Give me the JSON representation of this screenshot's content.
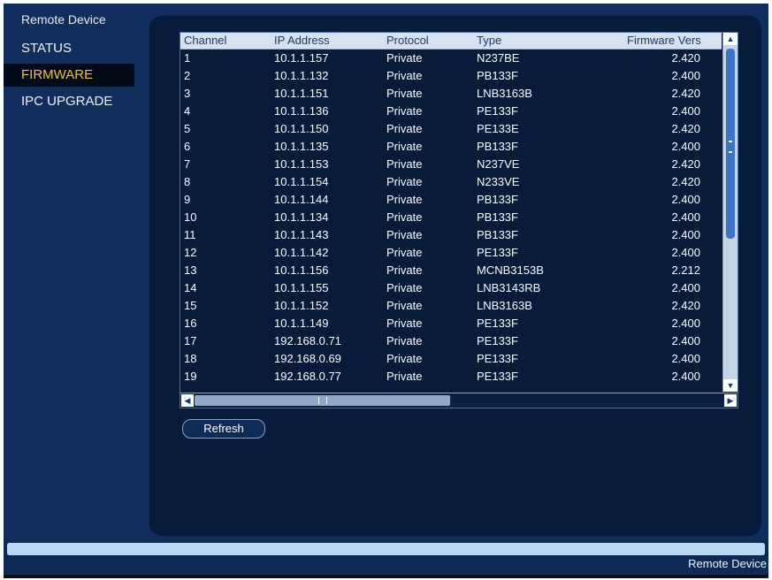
{
  "sidebar": {
    "header": "Remote Device",
    "items": [
      {
        "label": "STATUS"
      },
      {
        "label": "FIRMWARE"
      },
      {
        "label": "IPC UPGRADE"
      }
    ]
  },
  "table": {
    "columns": [
      "Channel",
      "IP Address",
      "Protocol",
      "Type",
      "Firmware Vers"
    ],
    "rows": [
      [
        "1",
        "10.1.1.157",
        "Private",
        "N237BE",
        "2.420"
      ],
      [
        "2",
        "10.1.1.132",
        "Private",
        "PB133F",
        "2.400"
      ],
      [
        "3",
        "10.1.1.151",
        "Private",
        "LNB3163B",
        "2.420"
      ],
      [
        "4",
        "10.1.1.136",
        "Private",
        "PE133F",
        "2.400"
      ],
      [
        "5",
        "10.1.1.150",
        "Private",
        "PE133E",
        "2.420"
      ],
      [
        "6",
        "10.1.1.135",
        "Private",
        "PB133F",
        "2.400"
      ],
      [
        "7",
        "10.1.1.153",
        "Private",
        "N237VE",
        "2.420"
      ],
      [
        "8",
        "10.1.1.154",
        "Private",
        "N233VE",
        "2.420"
      ],
      [
        "9",
        "10.1.1.144",
        "Private",
        "PB133F",
        "2.400"
      ],
      [
        "10",
        "10.1.1.134",
        "Private",
        "PB133F",
        "2.400"
      ],
      [
        "11",
        "10.1.1.143",
        "Private",
        "PB133F",
        "2.400"
      ],
      [
        "12",
        "10.1.1.142",
        "Private",
        "PE133F",
        "2.400"
      ],
      [
        "13",
        "10.1.1.156",
        "Private",
        "MCNB3153B",
        "2.212"
      ],
      [
        "14",
        "10.1.1.155",
        "Private",
        "LNB3143RB",
        "2.400"
      ],
      [
        "15",
        "10.1.1.152",
        "Private",
        "LNB3163B",
        "2.420"
      ],
      [
        "16",
        "10.1.1.149",
        "Private",
        "PE133F",
        "2.400"
      ],
      [
        "17",
        "192.168.0.71",
        "Private",
        "PE133F",
        "2.400"
      ],
      [
        "18",
        "192.168.0.69",
        "Private",
        "PE133F",
        "2.400"
      ],
      [
        "19",
        "192.168.0.77",
        "Private",
        "PE133F",
        "2.400"
      ]
    ]
  },
  "buttons": {
    "refresh": "Refresh"
  },
  "status": {
    "text": "Remote Device",
    "progress": 1.0
  },
  "colors": {
    "background": "#0f2e5c",
    "panel": "#071b3a",
    "active_item_text": "#f0c040",
    "header_bg": "#d6e2f1"
  },
  "icons": {
    "scroll_up": "triangle-up-icon",
    "scroll_down": "triangle-down-icon",
    "scroll_left": "triangle-left-icon",
    "scroll_right": "triangle-right-icon"
  }
}
